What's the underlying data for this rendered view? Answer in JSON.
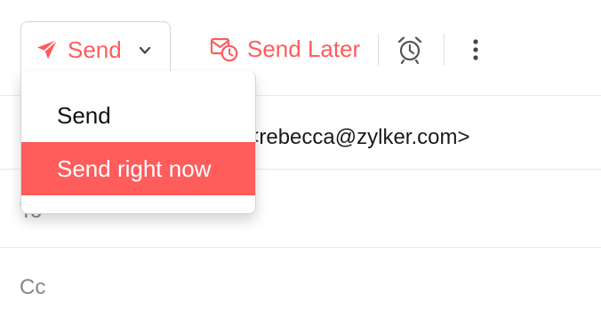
{
  "toolbar": {
    "send_label": "Send",
    "send_later_label": "Send Later"
  },
  "form": {
    "from_value": "rson <rebecca@zylker.com>",
    "to_label": "To",
    "cc_label": "Cc"
  },
  "send_menu": {
    "items": [
      {
        "label": "Send"
      },
      {
        "label": "Send right now"
      }
    ],
    "highlighted_index": 1
  },
  "colors": {
    "accent": "#ff5c5c",
    "border": "#d6d6d6",
    "muted_text": "#888888"
  },
  "icons": [
    "paper-plane-icon",
    "chevron-down-icon",
    "schedule-send-icon",
    "alarm-clock-icon",
    "more-vertical-icon"
  ]
}
